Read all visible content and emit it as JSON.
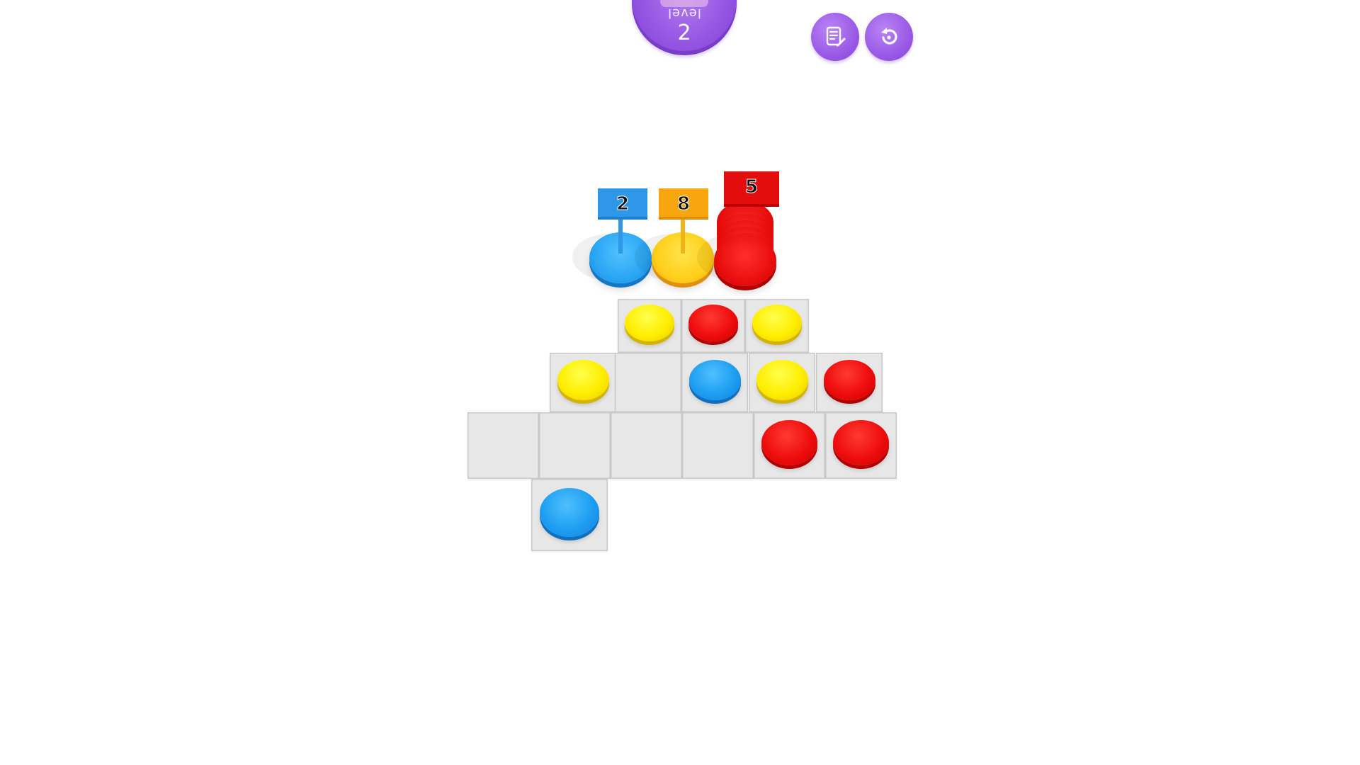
{
  "hud": {
    "level_label": "level",
    "level_number": "2",
    "notes_icon": "notepad-pencil-icon",
    "restart_icon": "restart-arrow-icon"
  },
  "colors": {
    "accent_purple": "#9a5ae6",
    "chip_yellow": "#ffee00",
    "chip_red": "#ee0d0d",
    "chip_blue": "#1e9ef2",
    "tile": "#e7e7e7"
  },
  "targets": [
    {
      "color": "blue",
      "count_label": "2"
    },
    {
      "color": "orange",
      "count_label": "8"
    },
    {
      "color": "red",
      "count_label": "5"
    }
  ],
  "board": {
    "rows": [
      {
        "cells": [
          null,
          null,
          "yellow",
          "red",
          "yellow",
          null
        ]
      },
      {
        "cells": [
          null,
          "yellow",
          "empty",
          "blue",
          "yellow",
          "red"
        ]
      },
      {
        "cells": [
          "empty",
          "empty",
          "empty",
          "empty",
          "red",
          "red"
        ]
      },
      {
        "cells": [
          null,
          "blue",
          null,
          null,
          null,
          null
        ]
      }
    ]
  }
}
